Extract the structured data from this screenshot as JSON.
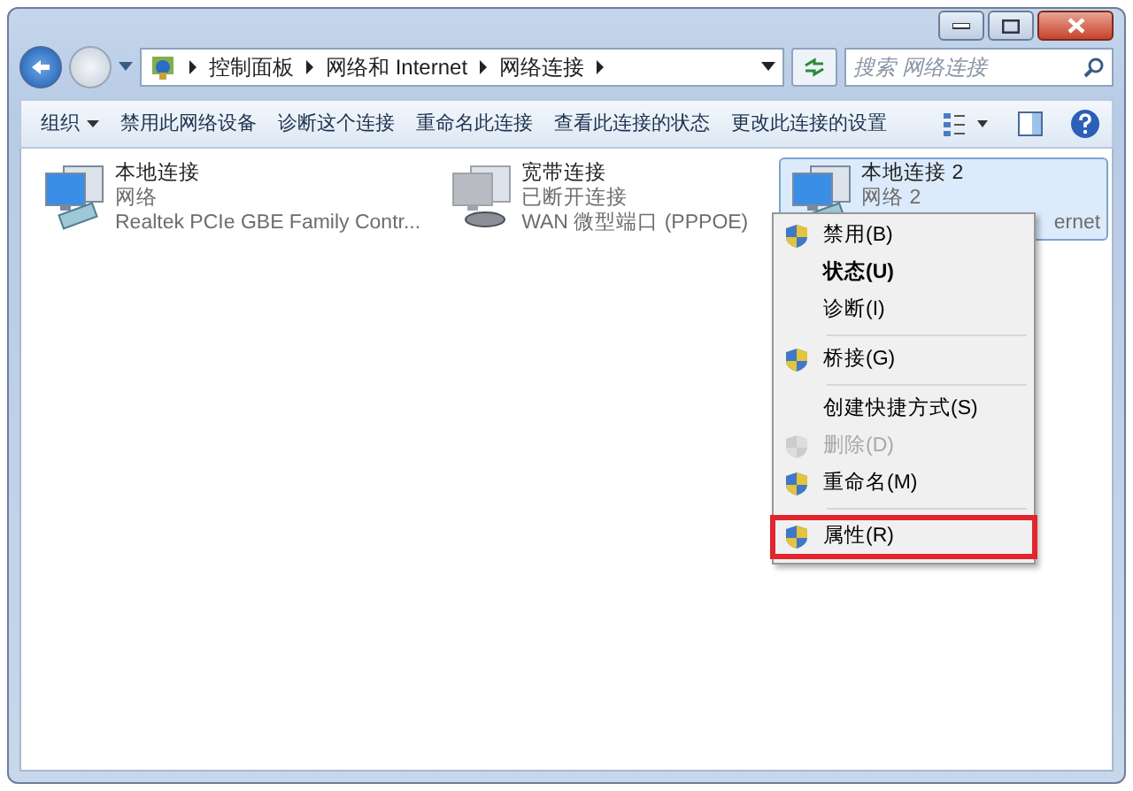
{
  "address_bar": {
    "breadcrumbs": [
      "控制面板",
      "网络和 Internet",
      "网络连接"
    ]
  },
  "search": {
    "placeholder": "搜索 网络连接"
  },
  "toolbar": {
    "buttons": [
      {
        "label": "组织",
        "has_menu": true
      },
      {
        "label": "禁用此网络设备",
        "has_menu": false
      },
      {
        "label": "诊断这个连接",
        "has_menu": false
      },
      {
        "label": "重命名此连接",
        "has_menu": false
      },
      {
        "label": "查看此连接的状态",
        "has_menu": false
      },
      {
        "label": "更改此连接的设置",
        "has_menu": false
      }
    ]
  },
  "connections": [
    {
      "name": "本地连接",
      "status": "网络",
      "device": "Realtek PCIe GBE Family Contr...",
      "kind": "lan",
      "connected": true,
      "selected": false
    },
    {
      "name": "宽带连接",
      "status": "已断开连接",
      "device": "WAN 微型端口 (PPPOE)",
      "kind": "broadband",
      "connected": false,
      "selected": false
    },
    {
      "name": "本地连接 2",
      "status": "网络 2",
      "device": "ernet",
      "kind": "lan",
      "connected": true,
      "selected": true
    }
  ],
  "context_menu": {
    "items": [
      {
        "kind": "item",
        "label": "禁用(B)",
        "shield": true,
        "bold": false,
        "disabled": false,
        "highlighted": false
      },
      {
        "kind": "item",
        "label": "状态(U)",
        "shield": false,
        "bold": true,
        "disabled": false,
        "highlighted": false
      },
      {
        "kind": "item",
        "label": "诊断(I)",
        "shield": false,
        "bold": false,
        "disabled": false,
        "highlighted": false
      },
      {
        "kind": "separator"
      },
      {
        "kind": "item",
        "label": "桥接(G)",
        "shield": true,
        "bold": false,
        "disabled": false,
        "highlighted": false
      },
      {
        "kind": "separator"
      },
      {
        "kind": "item",
        "label": "创建快捷方式(S)",
        "shield": false,
        "bold": false,
        "disabled": false,
        "highlighted": false
      },
      {
        "kind": "item",
        "label": "删除(D)",
        "shield": true,
        "bold": false,
        "disabled": true,
        "highlighted": false
      },
      {
        "kind": "item",
        "label": "重命名(M)",
        "shield": true,
        "bold": false,
        "disabled": false,
        "highlighted": false
      },
      {
        "kind": "separator"
      },
      {
        "kind": "item",
        "label": "属性(R)",
        "shield": true,
        "bold": false,
        "disabled": false,
        "highlighted": true
      }
    ]
  }
}
